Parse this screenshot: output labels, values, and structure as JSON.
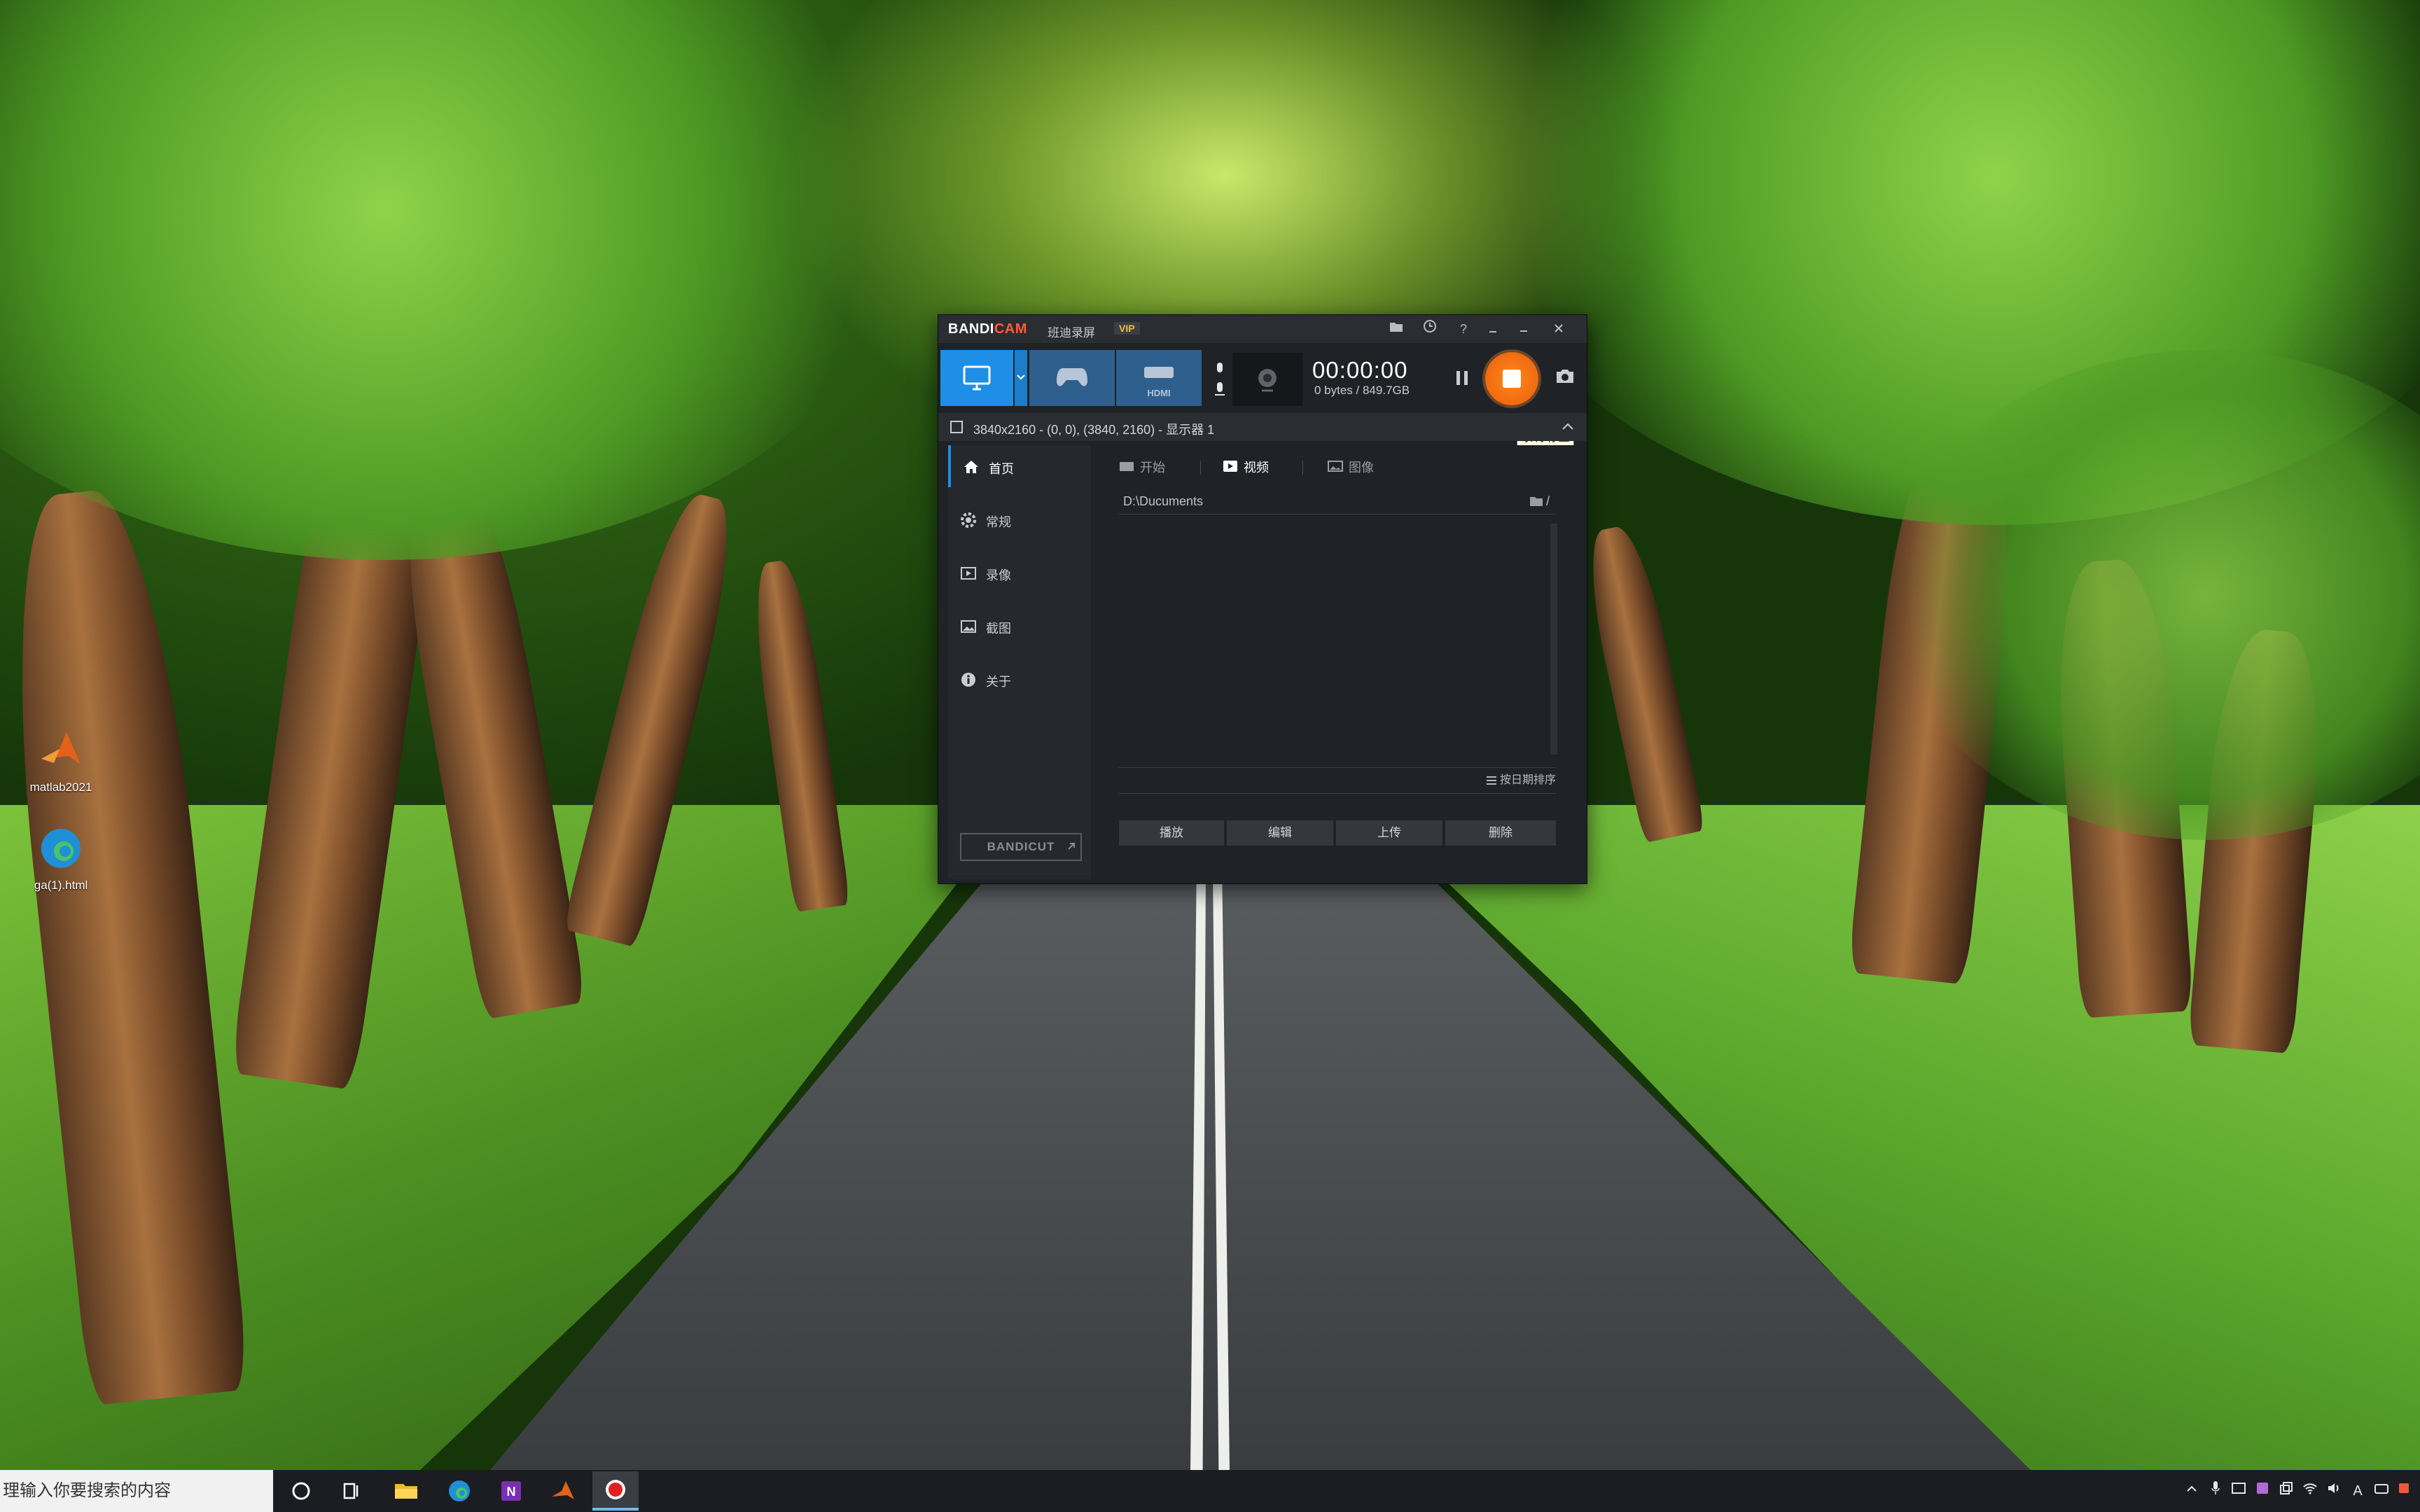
{
  "window": {
    "brand_left": "BANDI",
    "brand_right": "CAM",
    "brand_cn": "班迪录屏",
    "vip": "VIP",
    "title_buttons": [
      "folder-icon",
      "clock-icon",
      "help-icon",
      "minimize-icon",
      "close-icon"
    ]
  },
  "toolbar": {
    "modes": [
      "screen-mode",
      "game-mode",
      "device-mode"
    ],
    "device_label": "HDMI",
    "timer": "00:00:00",
    "bytes": "0 bytes / 849.7GB",
    "record_tooltip": "录制/停止",
    "accent": "#1e8ee6",
    "record_color": "#f06a10"
  },
  "area_bar": {
    "text": "3840x2160 - (0, 0), (3840, 2160) - 显示器 1"
  },
  "sidebar": {
    "items": [
      {
        "label": "首页",
        "icon": "home-icon",
        "active": true
      },
      {
        "label": "常规",
        "icon": "gear-icon",
        "active": false
      },
      {
        "label": "录像",
        "icon": "video-icon",
        "active": false
      },
      {
        "label": "截图",
        "icon": "image-icon",
        "active": false
      },
      {
        "label": "关于",
        "icon": "info-icon",
        "active": false
      }
    ],
    "bandicut": "BANDICUT"
  },
  "main": {
    "tabs": [
      {
        "label": "开始",
        "icon": "start-icon",
        "active": false
      },
      {
        "label": "视频",
        "icon": "play-icon",
        "active": true
      },
      {
        "label": "图像",
        "icon": "picture-icon",
        "active": false
      }
    ],
    "path": "D:\\Ducuments",
    "path_suffix": "/",
    "sort_label": "按日期排序",
    "actions": [
      "播放",
      "编辑",
      "上传",
      "删除"
    ]
  },
  "desktop_icons": [
    {
      "label": "matlab2021"
    },
    {
      "label": "ga(1).html"
    }
  ],
  "taskbar": {
    "search_placeholder": "理输入你要搜索的内容",
    "tray_input": "A"
  }
}
